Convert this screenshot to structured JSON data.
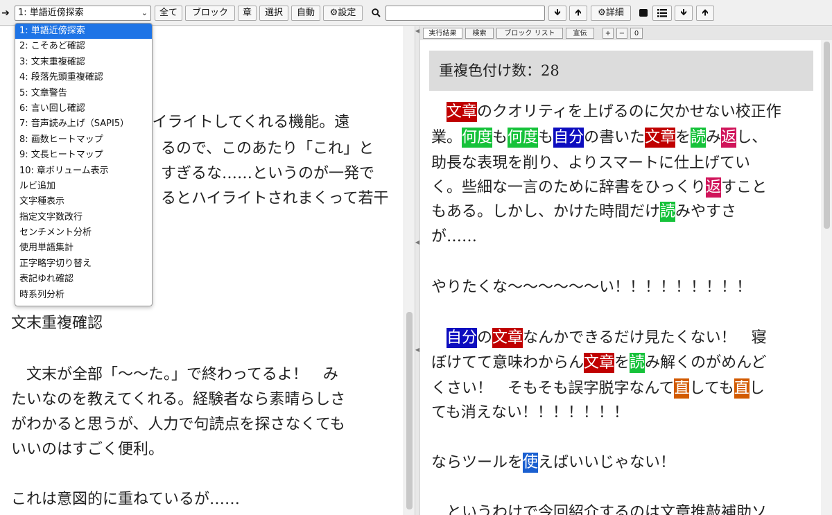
{
  "colors": {
    "red": "#c00000",
    "green": "#16c23a",
    "navy": "#0d0dbf",
    "crimson": "#d0145a",
    "orange": "#d25a00",
    "blue": "#1a5fd0",
    "selected": "#1e74e6"
  },
  "toolbar": {
    "go_icon": "➔",
    "select_value": "1: 単語近傍探索",
    "all_label": "全て",
    "block_label": "ブロック",
    "chapter_label": "章",
    "select_label": "選択",
    "auto_label": "自動",
    "settings_label": "設定",
    "search_icon": "🔍",
    "search_value": "",
    "details_label": "詳細"
  },
  "dropdown": {
    "items": [
      "1: 単語近傍探索",
      "2: こそあど確認",
      "3: 文末重複確認",
      "4: 段落先頭重複確認",
      "5: 文章警告",
      "6: 言い回し確認",
      "7: 音声読み上げ（SAPI5）",
      "8: 画数ヒートマップ",
      "9: 文長ヒートマップ",
      "10: 章ボリューム表示",
      "ルビ追加",
      "文字種表示",
      "指定文字数改行",
      "センチメント分析",
      "使用単語集計",
      "正字略字切り替え",
      "表記ゆれ確認",
      "時系列分析"
    ]
  },
  "left": {
    "line1": "ハイライトしてくれる機能。遠",
    "line2": "るので、このあたり「これ」と",
    "line3": "すぎるな……というのが一発で",
    "line4": "るとハイライトされまくって若干",
    "heading": "文末重複確認",
    "p1": "　文末が全部「〜〜た。」で終わってるよ！　み",
    "p2": "たいなのを教えてくれる。経験者なら素晴らしさ",
    "p3": "がわかると思うが、人力で句読点を探さなくても",
    "p4": "いいのはすごく便利。",
    "p5": "これは意図的に重ねているが……"
  },
  "tabs": {
    "t1": "実行結果",
    "t2": "検索",
    "t3": "ブロック リスト",
    "t4": "宣伝",
    "plus": "+",
    "minus": "−",
    "zero": "0"
  },
  "right": {
    "count_label": "重複色付け数：28",
    "l1": [
      {
        "t": "　",
        "c": ""
      },
      {
        "t": "文章",
        "c": "red"
      },
      {
        "t": "のクオリティを上げるのに欠かせない校正作",
        "c": ""
      }
    ],
    "l2": [
      {
        "t": "業。",
        "c": ""
      },
      {
        "t": "何度",
        "c": "green"
      },
      {
        "t": "も",
        "c": ""
      },
      {
        "t": "何度",
        "c": "green"
      },
      {
        "t": "も",
        "c": ""
      },
      {
        "t": "自分",
        "c": "navy"
      },
      {
        "t": "の書いた",
        "c": ""
      },
      {
        "t": "文章",
        "c": "red"
      },
      {
        "t": "を",
        "c": ""
      },
      {
        "t": "読",
        "c": "green"
      },
      {
        "t": "み",
        "c": ""
      },
      {
        "t": "返",
        "c": "crimson"
      },
      {
        "t": "し、",
        "c": ""
      }
    ],
    "l3": [
      {
        "t": "助長な表現を削り、よりスマートに仕上げてい",
        "c": ""
      }
    ],
    "l4": [
      {
        "t": "く。些細な一言のために辞書をひっくり",
        "c": ""
      },
      {
        "t": "返",
        "c": "crimson"
      },
      {
        "t": "すこと",
        "c": ""
      }
    ],
    "l5": [
      {
        "t": "もある。しかし、かけた時間だけ",
        "c": ""
      },
      {
        "t": "読",
        "c": "green"
      },
      {
        "t": "みやすさ",
        "c": ""
      }
    ],
    "l6": [
      {
        "t": "が……",
        "c": ""
      }
    ],
    "l7": [
      {
        "t": "やりたくな〜〜〜〜〜〜い！！！！！！！！！",
        "c": ""
      }
    ],
    "l8": [
      {
        "t": "　",
        "c": ""
      },
      {
        "t": "自分",
        "c": "navy"
      },
      {
        "t": "の",
        "c": ""
      },
      {
        "t": "文章",
        "c": "red"
      },
      {
        "t": "なんかできるだけ見たくない！　寝",
        "c": ""
      }
    ],
    "l9": [
      {
        "t": "ぼけてて意味わからん",
        "c": ""
      },
      {
        "t": "文章",
        "c": "red"
      },
      {
        "t": "を",
        "c": ""
      },
      {
        "t": "読",
        "c": "green"
      },
      {
        "t": "み解くのがめんど",
        "c": ""
      }
    ],
    "l10": [
      {
        "t": "くさい！　そもそも誤字脱字なんて",
        "c": ""
      },
      {
        "t": "直",
        "c": "orange"
      },
      {
        "t": "しても",
        "c": ""
      },
      {
        "t": "直",
        "c": "orange"
      },
      {
        "t": "し",
        "c": ""
      }
    ],
    "l11": [
      {
        "t": "ても消えない！！！！！！！",
        "c": ""
      }
    ],
    "l12": [
      {
        "t": "ならツールを",
        "c": ""
      },
      {
        "t": "使",
        "c": "blue"
      },
      {
        "t": "えばいいじゃない！",
        "c": ""
      }
    ],
    "l13": [
      {
        "t": "　というわけで今回紹介するのは文章推敲補助ソ",
        "c": ""
      }
    ]
  }
}
